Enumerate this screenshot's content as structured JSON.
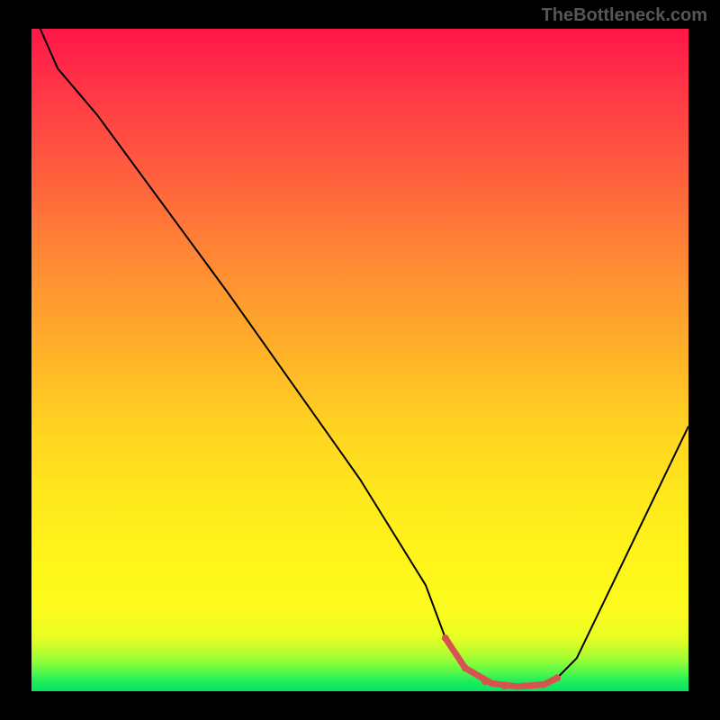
{
  "watermark": "TheBottleneck.com",
  "colors": {
    "accent": "#d8534f",
    "curve": "#000000",
    "background_black": "#000000"
  },
  "chart_data": {
    "type": "line",
    "title": "",
    "xlabel": "",
    "ylabel": "",
    "xlim": [
      0,
      100
    ],
    "ylim": [
      0,
      100
    ],
    "background": "vertical-gradient-red-to-green",
    "series": [
      {
        "name": "bottleneck-curve",
        "x": [
          0,
          4,
          10,
          20,
          30,
          40,
          50,
          60,
          63,
          66,
          70,
          74,
          78,
          80,
          83,
          100
        ],
        "y": [
          103,
          94,
          87,
          73.5,
          60,
          46,
          32,
          16,
          8,
          3.5,
          1.2,
          0.7,
          1.0,
          2.0,
          5.0,
          40
        ]
      }
    ],
    "accent_region": {
      "name": "optimal-range",
      "x": [
        63,
        66,
        70,
        74,
        78,
        80
      ],
      "y": [
        8,
        3.5,
        1.2,
        0.7,
        1.0,
        2.0
      ],
      "dots_x": [
        63,
        66,
        69,
        72,
        75,
        78,
        80
      ],
      "dots_y": [
        8,
        3.5,
        1.5,
        0.8,
        0.8,
        1.0,
        2.0
      ]
    }
  }
}
